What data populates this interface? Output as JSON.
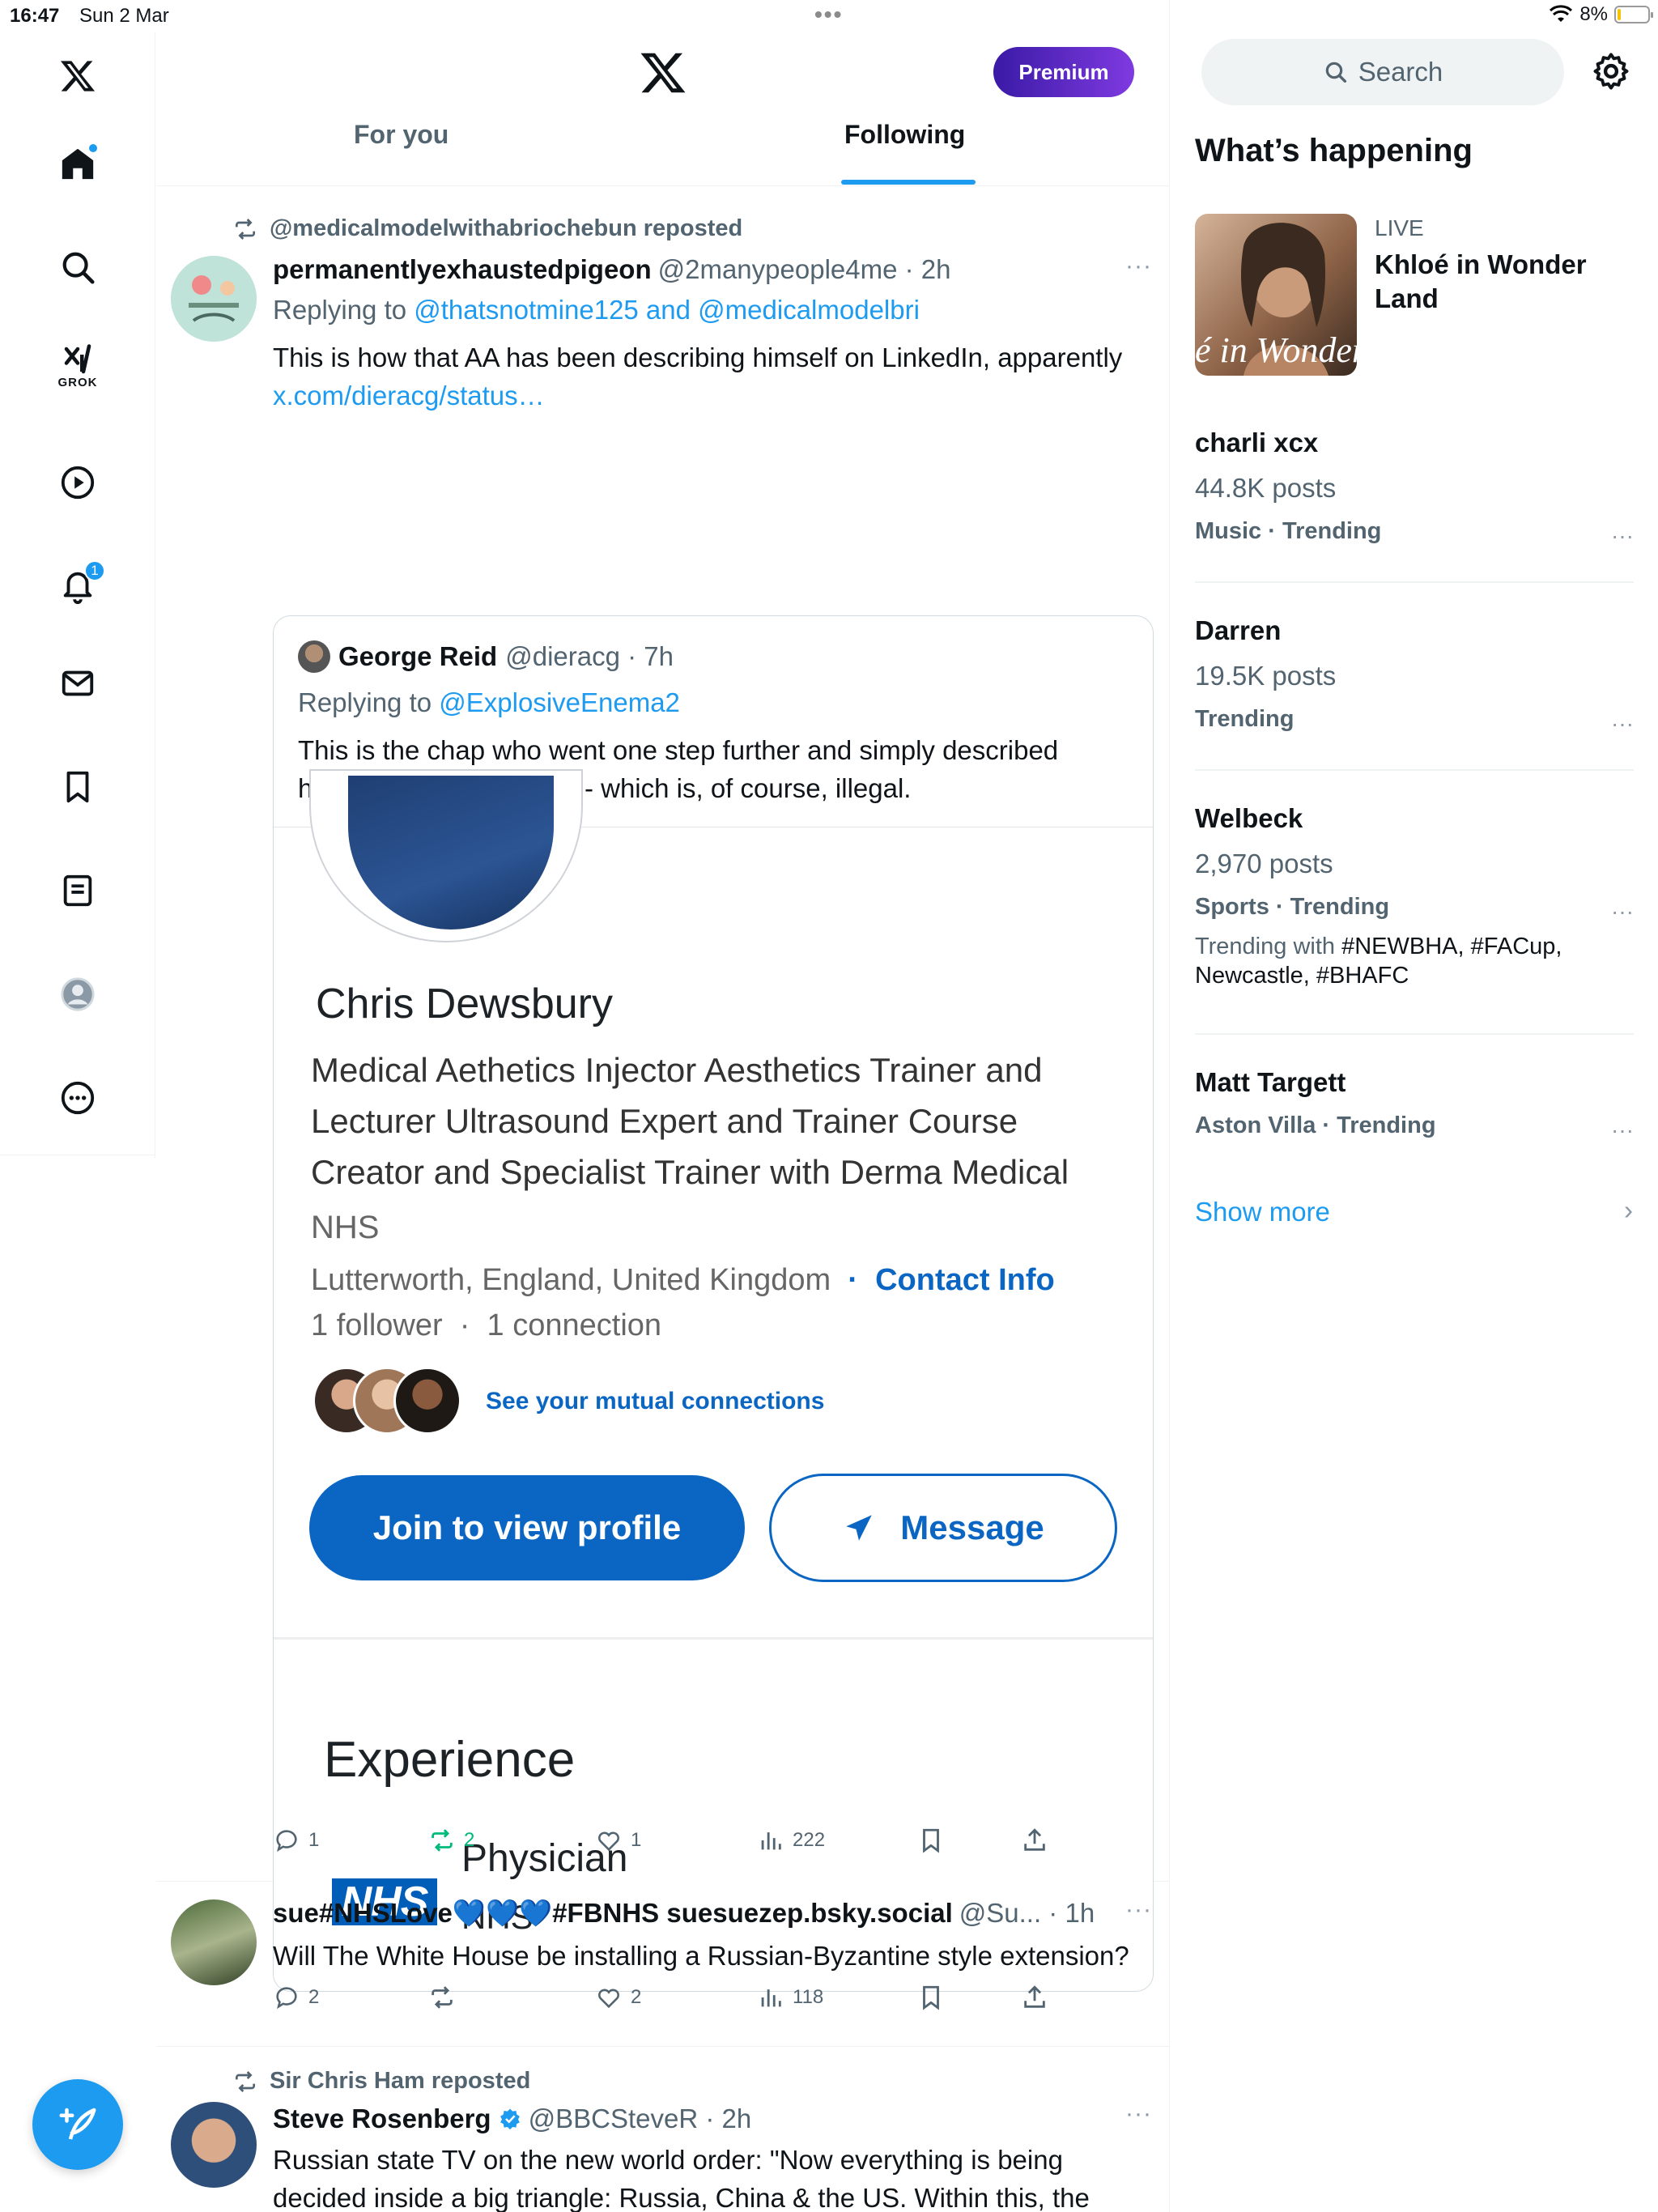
{
  "status_bar": {
    "time": "16:47",
    "date": "Sun 2 Mar",
    "dots": "•••",
    "battery": "8%"
  },
  "nav": {
    "grok_label": "GROK",
    "notifications_count": "1"
  },
  "header": {
    "premium_label": "Premium",
    "tabs": [
      {
        "label": "For you",
        "selected": false
      },
      {
        "label": "Following",
        "selected": true
      }
    ]
  },
  "tweets": [
    {
      "repost_by": "@medicalmodelwithabriochebun reposted",
      "name": "permanentlyexhaustedpigeon",
      "handle": "@2manypeople4me · 2h",
      "reply_prefix": "Replying to ",
      "reply_to": "@thatsnotmine125 and @medicalmodelbri",
      "text": "This is how that AA has been describing himself on LinkedIn, apparently",
      "link": "x.com/dieracg/status…",
      "more": "···",
      "quote": {
        "name": "George Reid",
        "handle": "@dieracg · 7h",
        "reply_prefix": "Replying to ",
        "reply_to": "@ExplosiveEnema2",
        "text": "This is the chap who went one step further and simply described himself as a “physician” - which is, of course, illegal.",
        "linkedin": {
          "name": "Chris Dewsbury",
          "headline": "Medical Aethetics Injector Aesthetics Trainer and Lecturer Ultrasound Expert and Trainer Course Creator and Specialist Trainer with Derma Medical",
          "org": "NHS",
          "location": "Lutterworth, England, United Kingdom",
          "contact_info": "Contact Info",
          "followers": "1 follower",
          "connections": "1 connection",
          "mutual": "See your mutual connections",
          "join_button": "Join to view profile",
          "message_button": "Message",
          "experience_title": "Experience",
          "nhs_logo_text": "NHS",
          "role": "Physician",
          "role_org": "NHS"
        }
      },
      "actions": {
        "replies": "1",
        "reposts": "2",
        "likes": "1",
        "views": "222"
      }
    },
    {
      "name": "sue#NHSLove💙💙💙#FBNHS suesuezep.bsky.social",
      "handle": "@Su... · 1h",
      "text": "Will The White House be installing a Russian-Byzantine style extension?",
      "more": "···",
      "actions": {
        "replies": "2",
        "reposts": "",
        "likes": "2",
        "views": "118"
      }
    },
    {
      "repost_by": "Sir Chris Ham reposted",
      "name": "Steve Rosenberg",
      "handle": "@BBCSteveR · 2h",
      "verified": true,
      "text": "Russian state TV on the new world order: \"Now everything is being decided inside a big triangle: Russia, China & the US. Within this, the",
      "more": "···"
    }
  ],
  "sidebar": {
    "search_placeholder": "Search",
    "whats_happening": "What’s happening",
    "live": {
      "label": "LIVE",
      "title": "Khloé in Wonder Land",
      "image_caption": "é in Wonder l"
    },
    "trends": [
      {
        "name": "charli xcx",
        "count": "44.8K posts",
        "category": "Music · Trending"
      },
      {
        "name": "Darren",
        "count": "19.5K posts",
        "category": "Trending"
      },
      {
        "name": "Welbeck",
        "count": "2,970 posts",
        "category": "Sports · Trending",
        "with_prefix": "Trending with ",
        "with_tags": "#NEWBHA, #FACup, Newcastle, #BHAFC"
      },
      {
        "name": "Matt Targett",
        "category": "Aston Villa · Trending"
      }
    ],
    "show_more": "Show more",
    "more_glyph": "···"
  },
  "colors": {
    "accent": "#1d9bf0",
    "linkedin_blue": "#0a66c2",
    "nhs_blue": "#005eb8",
    "repost_green": "#00ba7c"
  }
}
